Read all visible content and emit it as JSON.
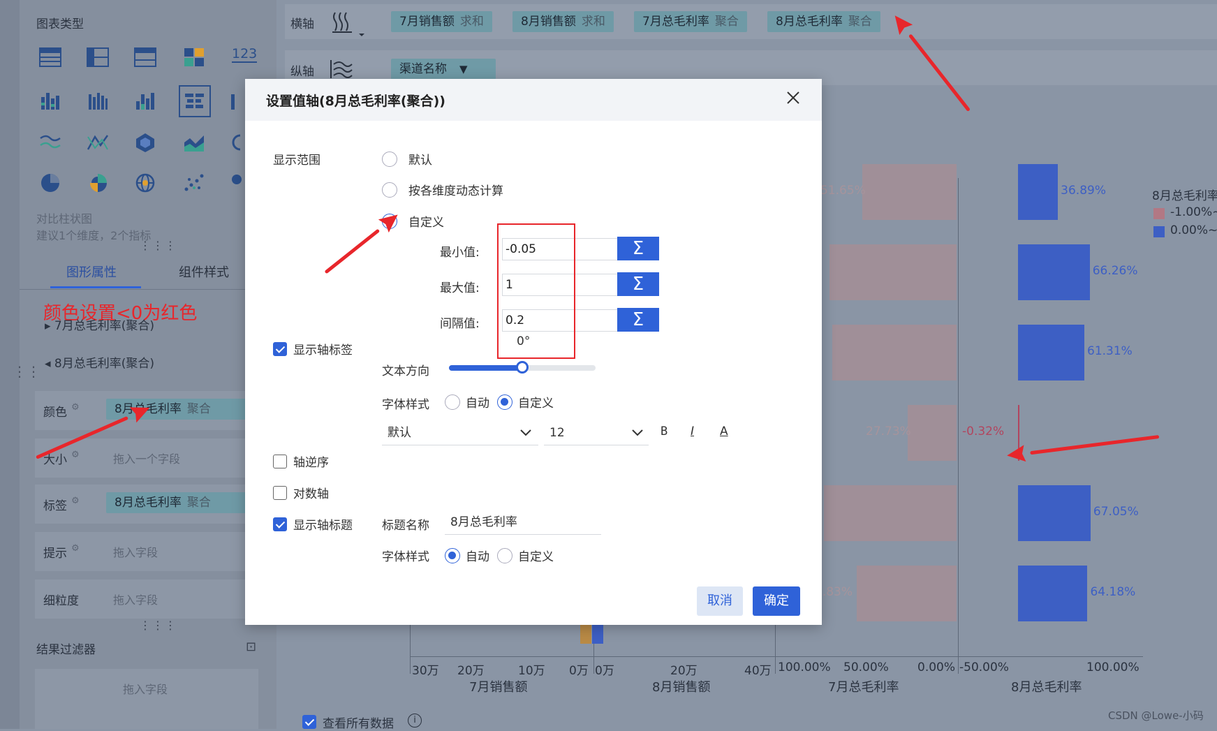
{
  "left": {
    "chart_type_title": "图表类型",
    "icon_123": "123",
    "selected_chart_name": "对比柱状图",
    "selected_chart_hint": "建议1个维度，2个指标",
    "tabs": [
      "图形属性",
      "组件样式"
    ],
    "annotation": "颜色设置<0为红色",
    "section_july": "▸ 7月总毛利率(聚合)",
    "section_aug": "◂ 8月总毛利率(聚合)",
    "rows": [
      {
        "label": "颜色",
        "value": "8月总毛利率",
        "agg": "聚合",
        "is_pill": true
      },
      {
        "label": "大小",
        "value": "拖入一个字段",
        "is_pill": false
      },
      {
        "label": "标签",
        "value": "8月总毛利率",
        "agg": "聚合",
        "is_pill": true
      },
      {
        "label": "提示",
        "value": "拖入字段",
        "is_pill": false
      },
      {
        "label": "细粒度",
        "value": "拖入字段",
        "is_pill": false
      }
    ],
    "filter_title": "结果过滤器",
    "filter_drop": "拖入字段"
  },
  "toolbar": {
    "x_label": "横轴",
    "y_label": "纵轴",
    "x_pills": [
      {
        "name": "7月销售额",
        "agg": "求和"
      },
      {
        "name": "8月销售额",
        "agg": "求和"
      },
      {
        "name": "7月总毛利率",
        "agg": "聚合"
      },
      {
        "name": "8月总毛利率",
        "agg": "聚合"
      }
    ],
    "y_pill": "渠道名称"
  },
  "chart": {
    "legend_title": "8月总毛利率",
    "legend_items": [
      "-1.00%~",
      "0.00%~"
    ],
    "colors": {
      "negative": "#a08f98",
      "positive": "#3d5fc4"
    },
    "july_margin_labels": [
      "51.65%",
      "",
      "",
      "27.73%",
      "",
      "1.83%"
    ],
    "aug_margin_values": [
      36.89,
      66.26,
      61.31,
      -0.32,
      67.05,
      64.18
    ],
    "aug_margin_labels": [
      "36.89%",
      "66.26%",
      "61.31%",
      "-0.32%",
      "67.05%",
      "64.18%"
    ],
    "axes": [
      {
        "ticks": [
          "30万",
          "20万",
          "10万",
          "0万"
        ],
        "title": "7月销售额"
      },
      {
        "ticks": [
          "0万",
          "20万",
          "40万"
        ],
        "title": "8月销售额"
      },
      {
        "ticks": [
          "100.00%",
          "50.00%",
          "0.00%"
        ],
        "title": "7月总毛利率"
      },
      {
        "ticks": [
          "-50.00%",
          "100.00%"
        ],
        "title": "8月总毛利率"
      }
    ],
    "view_all": "查看所有数据",
    "watermark": "CSDN @Lowe-小码"
  },
  "dialog": {
    "title": "设置值轴(8月总毛利率(聚合))",
    "range_label": "显示范围",
    "range_options": [
      "默认",
      "按各维度动态计算",
      "自定义"
    ],
    "range_selected": 2,
    "min_label": "最小值:",
    "min_value": "-0.05",
    "max_label": "最大值:",
    "max_value": "1",
    "step_label": "间隔值:",
    "step_value": "0.2",
    "sigma": "Σ",
    "show_axis_label": "显示轴标签",
    "angle": "0°",
    "text_direction": "文本方向",
    "font_style_label": "字体样式",
    "font_auto": "自动",
    "font_custom": "自定义",
    "font_family_value": "默认",
    "font_size_value": "12",
    "bold": "B",
    "italic": "I",
    "underline": "A",
    "reverse_axis": "轴逆序",
    "log_axis": "对数轴",
    "show_axis_title": "显示轴标题",
    "title_name_label": "标题名称",
    "title_name_value": "8月总毛利率",
    "font_style_label2": "字体样式",
    "font_auto2": "自动",
    "font_custom2": "自定义",
    "cancel": "取消",
    "ok": "确定"
  }
}
